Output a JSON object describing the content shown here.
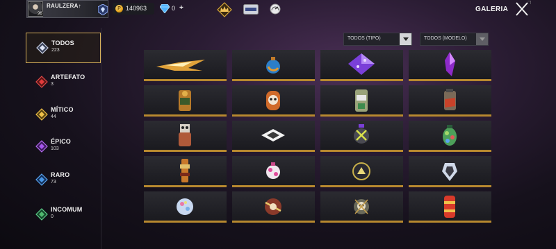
{
  "header": {
    "username": "RAULZERA↑",
    "level": "96",
    "coins": "140963",
    "coin_symbol": "P",
    "diamonds": "0",
    "diamond_plus": "+",
    "title": "GALERIA",
    "icons": [
      "rank-icon",
      "coin-icon",
      "diamond-icon",
      "elite-crown-icon",
      "pass-icon",
      "gauge-icon",
      "close-icon"
    ]
  },
  "sidebar": {
    "items": [
      {
        "label": "TODOS",
        "count": "223",
        "color": "#9aa7c9",
        "active": true
      },
      {
        "label": "ARTEFATO",
        "count": "3",
        "color": "#d23a3a",
        "active": false
      },
      {
        "label": "MÍTICO",
        "count": "44",
        "color": "#e6b73a",
        "active": false
      },
      {
        "label": "ÉPICO",
        "count": "103",
        "color": "#9a4ee0",
        "active": false
      },
      {
        "label": "RARO",
        "count": "73",
        "color": "#3f8fe0",
        "active": false
      },
      {
        "label": "INCOMUM",
        "count": "0",
        "color": "#4fb86e",
        "active": false
      }
    ]
  },
  "filters": {
    "type": {
      "value": "TODOS (TIPO)"
    },
    "model": {
      "value": "TODOS (MODELO)"
    }
  },
  "grid": {
    "rows": 5,
    "cols": 4,
    "items": [
      "golden-wing-item",
      "blue-orb-grenade",
      "purple-diamond-cube",
      "purple-crystal",
      "tiger-gloowall",
      "panda-grenade",
      "robot-grenade",
      "dragon-grenade",
      "robot-totem",
      "white-cube-emblem",
      "mecha-grenade",
      "green-cluster-grenade",
      "tall-totem",
      "pink-ball-grenade",
      "dark-orb-grenade",
      "crystal-gem",
      "pastel-orb",
      "samurai-grenade",
      "skull-grenade",
      "red-barrel-grenade"
    ]
  },
  "colors": {
    "accent_gold": "#d9b25b",
    "cell_border": "#b8892f",
    "background": "#1c1420"
  }
}
